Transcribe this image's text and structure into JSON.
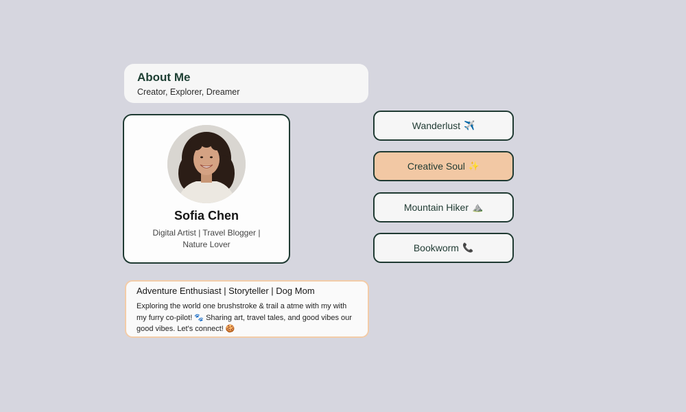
{
  "about": {
    "title": "About Me",
    "subtitle": "Creator, Explorer, Dreamer"
  },
  "profile": {
    "name": "Sofia Chen",
    "description": "Digital Artist | Travel Blogger | Nature Lover",
    "avatar": "profile-photo"
  },
  "tags": [
    {
      "label": "Wanderlust",
      "emoji": "✈️",
      "active": false
    },
    {
      "label": "Creative Soul",
      "emoji": "✨",
      "active": true
    },
    {
      "label": "Mountain Hiker",
      "emoji": "⛰️",
      "active": false
    },
    {
      "label": "Bookworm",
      "emoji": "📞",
      "active": false
    }
  ],
  "bio": {
    "headline": "Adventure Enthusiast | Storyteller | Dog Mom",
    "text": "Exploring the world one brushstroke & trail a atme with my with my furry co-pilot! 🐾 Sharing art, travel tales, and good vibes our good vibes. Let's connect! 🍪"
  },
  "colors": {
    "background": "#d6d6df",
    "accent_dark": "#1f3a32",
    "accent_peach": "#f2c8a4",
    "bio_border": "#f3cca8"
  }
}
